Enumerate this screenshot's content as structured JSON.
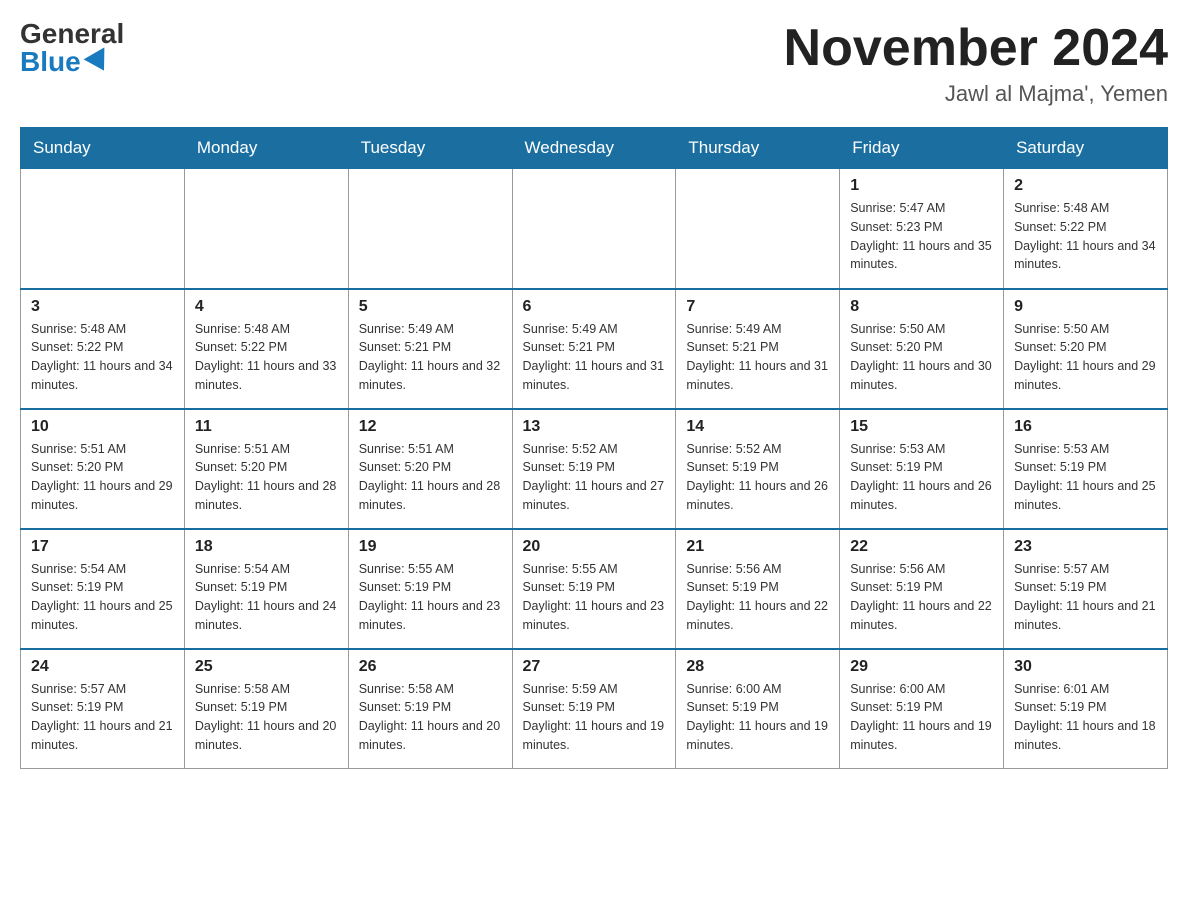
{
  "header": {
    "logo_general": "General",
    "logo_blue": "Blue",
    "month_title": "November 2024",
    "location": "Jawl al Majma', Yemen"
  },
  "days_of_week": [
    "Sunday",
    "Monday",
    "Tuesday",
    "Wednesday",
    "Thursday",
    "Friday",
    "Saturday"
  ],
  "weeks": [
    [
      {
        "day": "",
        "sunrise": "",
        "sunset": "",
        "daylight": ""
      },
      {
        "day": "",
        "sunrise": "",
        "sunset": "",
        "daylight": ""
      },
      {
        "day": "",
        "sunrise": "",
        "sunset": "",
        "daylight": ""
      },
      {
        "day": "",
        "sunrise": "",
        "sunset": "",
        "daylight": ""
      },
      {
        "day": "",
        "sunrise": "",
        "sunset": "",
        "daylight": ""
      },
      {
        "day": "1",
        "sunrise": "Sunrise: 5:47 AM",
        "sunset": "Sunset: 5:23 PM",
        "daylight": "Daylight: 11 hours and 35 minutes."
      },
      {
        "day": "2",
        "sunrise": "Sunrise: 5:48 AM",
        "sunset": "Sunset: 5:22 PM",
        "daylight": "Daylight: 11 hours and 34 minutes."
      }
    ],
    [
      {
        "day": "3",
        "sunrise": "Sunrise: 5:48 AM",
        "sunset": "Sunset: 5:22 PM",
        "daylight": "Daylight: 11 hours and 34 minutes."
      },
      {
        "day": "4",
        "sunrise": "Sunrise: 5:48 AM",
        "sunset": "Sunset: 5:22 PM",
        "daylight": "Daylight: 11 hours and 33 minutes."
      },
      {
        "day": "5",
        "sunrise": "Sunrise: 5:49 AM",
        "sunset": "Sunset: 5:21 PM",
        "daylight": "Daylight: 11 hours and 32 minutes."
      },
      {
        "day": "6",
        "sunrise": "Sunrise: 5:49 AM",
        "sunset": "Sunset: 5:21 PM",
        "daylight": "Daylight: 11 hours and 31 minutes."
      },
      {
        "day": "7",
        "sunrise": "Sunrise: 5:49 AM",
        "sunset": "Sunset: 5:21 PM",
        "daylight": "Daylight: 11 hours and 31 minutes."
      },
      {
        "day": "8",
        "sunrise": "Sunrise: 5:50 AM",
        "sunset": "Sunset: 5:20 PM",
        "daylight": "Daylight: 11 hours and 30 minutes."
      },
      {
        "day": "9",
        "sunrise": "Sunrise: 5:50 AM",
        "sunset": "Sunset: 5:20 PM",
        "daylight": "Daylight: 11 hours and 29 minutes."
      }
    ],
    [
      {
        "day": "10",
        "sunrise": "Sunrise: 5:51 AM",
        "sunset": "Sunset: 5:20 PM",
        "daylight": "Daylight: 11 hours and 29 minutes."
      },
      {
        "day": "11",
        "sunrise": "Sunrise: 5:51 AM",
        "sunset": "Sunset: 5:20 PM",
        "daylight": "Daylight: 11 hours and 28 minutes."
      },
      {
        "day": "12",
        "sunrise": "Sunrise: 5:51 AM",
        "sunset": "Sunset: 5:20 PM",
        "daylight": "Daylight: 11 hours and 28 minutes."
      },
      {
        "day": "13",
        "sunrise": "Sunrise: 5:52 AM",
        "sunset": "Sunset: 5:19 PM",
        "daylight": "Daylight: 11 hours and 27 minutes."
      },
      {
        "day": "14",
        "sunrise": "Sunrise: 5:52 AM",
        "sunset": "Sunset: 5:19 PM",
        "daylight": "Daylight: 11 hours and 26 minutes."
      },
      {
        "day": "15",
        "sunrise": "Sunrise: 5:53 AM",
        "sunset": "Sunset: 5:19 PM",
        "daylight": "Daylight: 11 hours and 26 minutes."
      },
      {
        "day": "16",
        "sunrise": "Sunrise: 5:53 AM",
        "sunset": "Sunset: 5:19 PM",
        "daylight": "Daylight: 11 hours and 25 minutes."
      }
    ],
    [
      {
        "day": "17",
        "sunrise": "Sunrise: 5:54 AM",
        "sunset": "Sunset: 5:19 PM",
        "daylight": "Daylight: 11 hours and 25 minutes."
      },
      {
        "day": "18",
        "sunrise": "Sunrise: 5:54 AM",
        "sunset": "Sunset: 5:19 PM",
        "daylight": "Daylight: 11 hours and 24 minutes."
      },
      {
        "day": "19",
        "sunrise": "Sunrise: 5:55 AM",
        "sunset": "Sunset: 5:19 PM",
        "daylight": "Daylight: 11 hours and 23 minutes."
      },
      {
        "day": "20",
        "sunrise": "Sunrise: 5:55 AM",
        "sunset": "Sunset: 5:19 PM",
        "daylight": "Daylight: 11 hours and 23 minutes."
      },
      {
        "day": "21",
        "sunrise": "Sunrise: 5:56 AM",
        "sunset": "Sunset: 5:19 PM",
        "daylight": "Daylight: 11 hours and 22 minutes."
      },
      {
        "day": "22",
        "sunrise": "Sunrise: 5:56 AM",
        "sunset": "Sunset: 5:19 PM",
        "daylight": "Daylight: 11 hours and 22 minutes."
      },
      {
        "day": "23",
        "sunrise": "Sunrise: 5:57 AM",
        "sunset": "Sunset: 5:19 PM",
        "daylight": "Daylight: 11 hours and 21 minutes."
      }
    ],
    [
      {
        "day": "24",
        "sunrise": "Sunrise: 5:57 AM",
        "sunset": "Sunset: 5:19 PM",
        "daylight": "Daylight: 11 hours and 21 minutes."
      },
      {
        "day": "25",
        "sunrise": "Sunrise: 5:58 AM",
        "sunset": "Sunset: 5:19 PM",
        "daylight": "Daylight: 11 hours and 20 minutes."
      },
      {
        "day": "26",
        "sunrise": "Sunrise: 5:58 AM",
        "sunset": "Sunset: 5:19 PM",
        "daylight": "Daylight: 11 hours and 20 minutes."
      },
      {
        "day": "27",
        "sunrise": "Sunrise: 5:59 AM",
        "sunset": "Sunset: 5:19 PM",
        "daylight": "Daylight: 11 hours and 19 minutes."
      },
      {
        "day": "28",
        "sunrise": "Sunrise: 6:00 AM",
        "sunset": "Sunset: 5:19 PM",
        "daylight": "Daylight: 11 hours and 19 minutes."
      },
      {
        "day": "29",
        "sunrise": "Sunrise: 6:00 AM",
        "sunset": "Sunset: 5:19 PM",
        "daylight": "Daylight: 11 hours and 19 minutes."
      },
      {
        "day": "30",
        "sunrise": "Sunrise: 6:01 AM",
        "sunset": "Sunset: 5:19 PM",
        "daylight": "Daylight: 11 hours and 18 minutes."
      }
    ]
  ]
}
